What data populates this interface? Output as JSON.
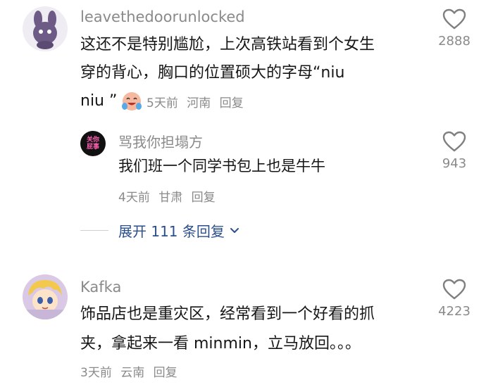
{
  "comments": [
    {
      "username": "leavethedoorunlocked",
      "line1": "这还不是特别尴尬，上次高铁站看到个女生",
      "line2": "穿的背心，胸口的位置硕大的字母“niu",
      "line3": "niu ”",
      "time": "5天前",
      "location": "河南",
      "reply_label": "回复",
      "likes": "2888"
    },
    {
      "username": "骂我你担塌方",
      "avatar_text": "关你屁事",
      "line1": "我们班一个同学书包上也是牛牛",
      "time": "4天前",
      "location": "甘肃",
      "reply_label": "回复",
      "likes": "943"
    },
    {
      "username": "Kafka",
      "line1": "饰品店也是重灾区，经常看到一个好看的抓",
      "line2": "夹，拿起来一看 minmin，立马放回。。。",
      "time": "3天前",
      "location": "云南",
      "reply_label": "回复",
      "likes": "4223"
    }
  ],
  "expand_replies": {
    "label": "展开 111 条回复"
  },
  "icons": {
    "like": "heart-outline-icon",
    "emoji": "crying-laughing-emoji-icon",
    "expand": "chevron-down-icon"
  },
  "colors": {
    "link": "#2b4f8d",
    "secondary": "#8a8a8a",
    "text": "#161616"
  }
}
